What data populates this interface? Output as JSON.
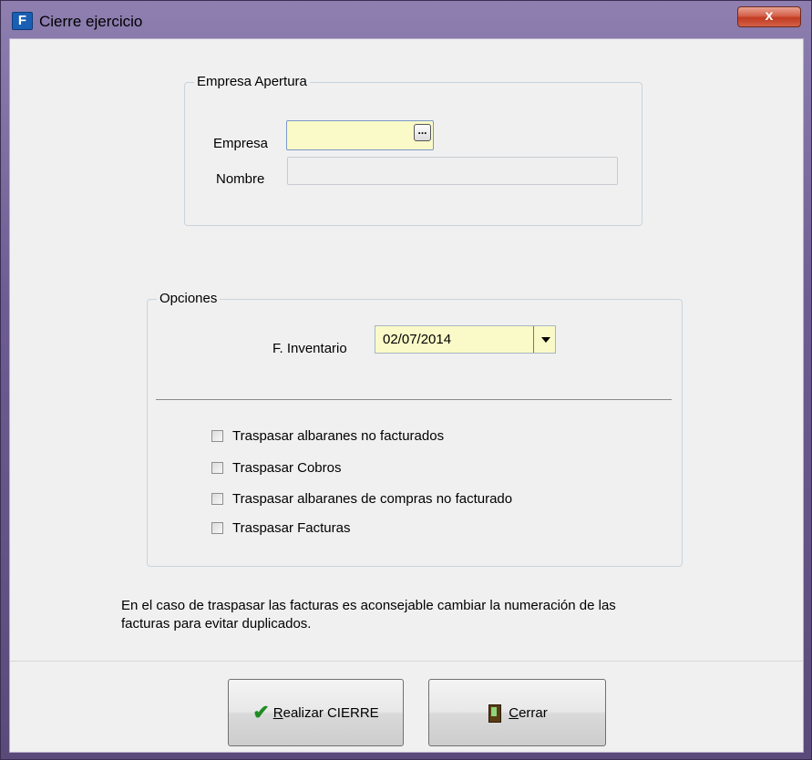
{
  "window": {
    "title": "Cierre ejercicio",
    "close_glyph": "x"
  },
  "empresa_group": {
    "title": "Empresa Apertura",
    "empresa_label": "Empresa",
    "empresa_value": "",
    "ellipsis": "...",
    "nombre_label": "Nombre",
    "nombre_value": ""
  },
  "opciones_group": {
    "title": "Opciones",
    "inventario_label": "F. Inventario",
    "inventario_value": "02/07/2014",
    "checkboxes": [
      {
        "label": "Traspasar albaranes no facturados",
        "checked": false
      },
      {
        "label": "Traspasar Cobros",
        "checked": false
      },
      {
        "label": "Traspasar albaranes de compras no facturado",
        "checked": false
      },
      {
        "label": "Traspasar Facturas",
        "checked": false
      }
    ]
  },
  "info": {
    "line1": "En el caso de traspasar las facturas es aconsejable cambiar la numeración de las",
    "line2": "facturas para evitar duplicados."
  },
  "buttons": {
    "realizar_hotkey": "R",
    "realizar_rest": "ealizar CIERRE",
    "cerrar_hotkey": "C",
    "cerrar_rest": "errar"
  },
  "colors": {
    "input_yellow": "#fafac8",
    "titlebar": "#6d5c92",
    "close_button": "#c23b22"
  }
}
